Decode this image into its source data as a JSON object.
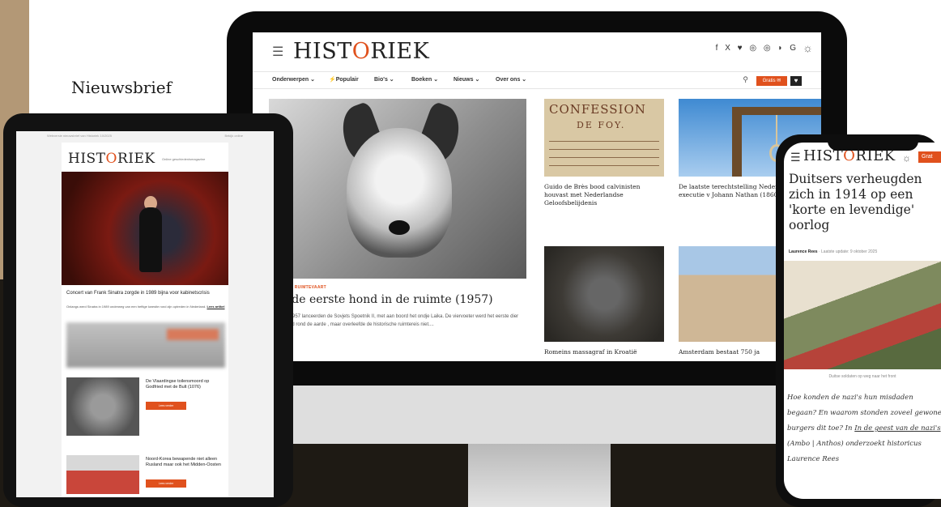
{
  "promo": {
    "label": "Nieuwsbrief"
  },
  "brand": {
    "pre": "HIST",
    "accent": "O",
    "post": "RIEK",
    "accent_color": "#e0511d"
  },
  "desktop": {
    "social_icons": "f X ♥ ◎ ◎ ◗ G",
    "nav": [
      "Onderwerpen ⌄",
      "⚡Populair",
      "Bio's ⌄",
      "Boeken ⌄",
      "Nieuws ⌄",
      "Over ons ⌄"
    ],
    "nav_button": "Gratis ✉",
    "hero": {
      "category": "DIERE EN RUIMTEVAART",
      "title": "a – de eerste hond in de ruimte (1957)",
      "excerpt": "vember 1957 lanceerden de Sovjets Spoetnik II, met aan boord het ondje Laika. De viervoeter werd het eerste dier dat levend rond de aarde , maar overleefde de historische ruimtereis niet...."
    },
    "confession": {
      "line1": "CONFESSION",
      "line2": "DE FOY."
    },
    "cards": [
      "Guido de Brès bood calvinisten houvast met Nederlandse Geloofsbelijdenis",
      "De laatste terechtstelling Nederland: de executie v Johann Nathan (1860)",
      "Romeins massagraf in Kroatië",
      "Amsterdam bestaat 750 ja"
    ]
  },
  "tablet": {
    "top_left": "Webversie nieuwsbrief van Historiek 10/2025",
    "top_right": "Bekijk online",
    "subtitle": "Online geschiedenismagazine",
    "hero_title": "Concert van Frank Sinatra zorgde in 1989 bijna voor kabinetscrisis",
    "hero_text": "Onlangs werd Sinatra in 1989 onderweg van een heftige kwestie rond zijn optreden in Nederland.",
    "hero_link": "Lees artikel",
    "items": [
      {
        "title": "De Vlaardingse toilensmoord op Godfried met de Bult (1076)",
        "button": "Lees verder"
      },
      {
        "title": "Noord-Korea bewapende niet alleen Rusland maar ook het Midden-Oosten",
        "button": "Lees verder"
      }
    ]
  },
  "phone": {
    "button": "Grat",
    "title": "Duitsers verheugden zich in 1914 op een 'korte en levendige' oorlog",
    "author": "Laurence Rees",
    "updated": "· Laatste update: 9 oktober 2025",
    "caption": "Duitse soldaten op weg naar het front",
    "body_before": "Hoe konden de nazi's hun misdaden begaan? En waarom stonden zoveel gewone burgers dit toe? In ",
    "body_link": "In de geest van de nazi's",
    "body_after": " (Ambo | Anthos) onderzoekt historicus Laurence Rees"
  }
}
